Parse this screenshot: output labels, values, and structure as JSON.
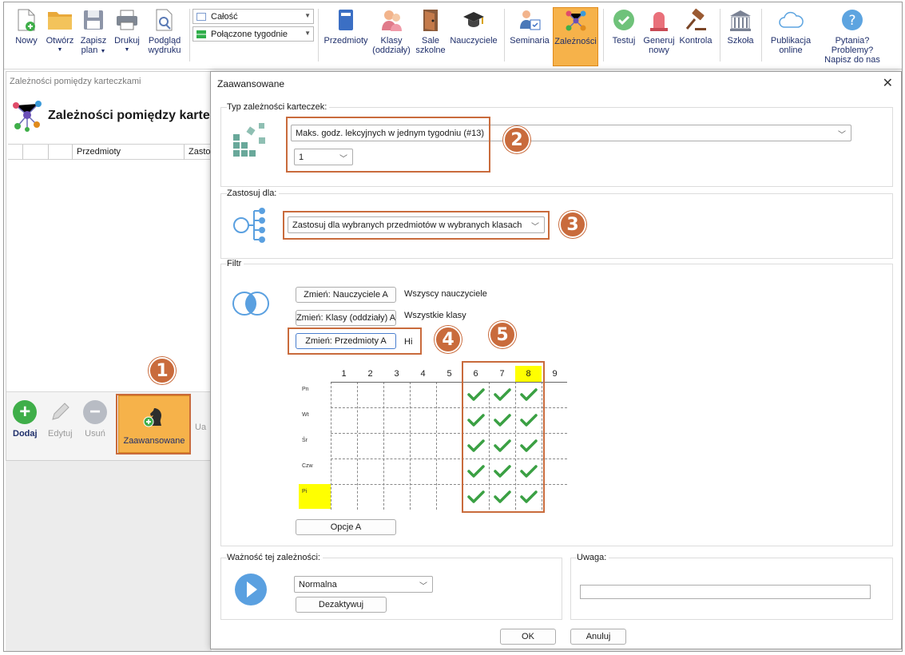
{
  "toolbar": {
    "new": "Nowy",
    "open": "Otwórz",
    "save_line1": "Zapisz",
    "save_line2": "plan",
    "print": "Drukuj",
    "preview_line1": "Podgląd",
    "preview_line2": "wydruku",
    "combo_scope": "Całość",
    "combo_weeks": "Połączone tygodnie",
    "subjects": "Przedmioty",
    "classes_line1": "Klasy",
    "classes_line2": "(oddziały)",
    "rooms_line1": "Sale",
    "rooms_line2": "szkolne",
    "teachers": "Nauczyciele",
    "seminars": "Seminaria",
    "relations": "Zależności",
    "test": "Testuj",
    "generate_line1": "Generuj",
    "generate_line2": "nowy",
    "control": "Kontrola",
    "school": "Szkoła",
    "publish_line1": "Publikacja",
    "publish_line2": "online",
    "help_line1": "Pytania? Problemy?",
    "help_line2": "Napisz do nas",
    "accent_color": "#f6b24a"
  },
  "bg_window": {
    "title": "Zależności pomiędzy karteczkami",
    "heading": "Zależności pomiędzy karte",
    "col_subjects": "Przedmioty",
    "col_apply": "Zasto",
    "add": "Dodaj",
    "edit": "Edytuj",
    "delete": "Usuń",
    "advanced": "Zaawansowane",
    "cut_label": "Ua"
  },
  "dialog": {
    "title": "Zaawansowane",
    "type_group": "Typ zależności karteczek:",
    "type_value": "Maks. godz. lekcyjnych w jednym tygodniu (#13)",
    "count_value": "1",
    "apply_group": "Zastosuj dla:",
    "apply_value": "Zastosuj dla wybranych przedmiotów w wybranych klasach",
    "filter_group": "Filtr",
    "btn_teachers": "Zmień: Nauczyciele A",
    "teachers_value": "Wszyscy nauczyciele",
    "btn_classes": "Zmień: Klasy (oddziały) A",
    "classes_value": "Wszystkie klasy",
    "btn_subjects": "Zmień: Przedmioty A",
    "subjects_value": "Hi",
    "options_btn": "Opcje A",
    "importance_group": "Ważność tej zależności:",
    "importance_value": "Normalna",
    "deactivate": "Dezaktywuj",
    "note_group": "Uwaga:",
    "ok": "OK",
    "cancel": "Anuluj"
  },
  "schedule": {
    "columns": [
      "1",
      "2",
      "3",
      "4",
      "5",
      "6",
      "7",
      "8",
      "9"
    ],
    "highlight_column": "8",
    "rows": [
      "Pn",
      "Wt",
      "Śr",
      "Czw",
      "Pi"
    ],
    "highlight_row": "Pi",
    "checked_columns": [
      "6",
      "7",
      "8"
    ],
    "highlight_color": "#ffff00"
  },
  "annotations": {
    "b1": "1",
    "b2": "2",
    "b3": "3",
    "b4": "4",
    "b5": "5",
    "color": "#c96b3c"
  }
}
